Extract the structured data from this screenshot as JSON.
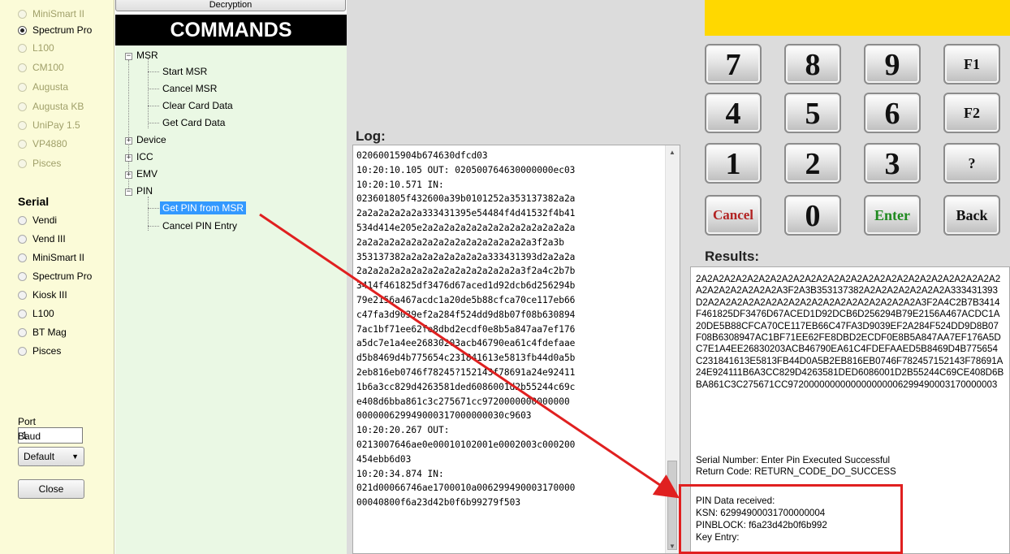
{
  "devices_usb": [
    {
      "label": "MiniSmart II",
      "selected": false,
      "enabled": false
    },
    {
      "label": "Spectrum Pro",
      "selected": true,
      "enabled": true
    },
    {
      "label": "L100",
      "selected": false,
      "enabled": false
    },
    {
      "label": "CM100",
      "selected": false,
      "enabled": false
    },
    {
      "label": "Augusta",
      "selected": false,
      "enabled": false
    },
    {
      "label": "Augusta KB",
      "selected": false,
      "enabled": false
    },
    {
      "label": "UniPay 1.5",
      "selected": false,
      "enabled": false
    },
    {
      "label": "VP4880",
      "selected": false,
      "enabled": false
    },
    {
      "label": "Pisces",
      "selected": false,
      "enabled": false
    }
  ],
  "serial": {
    "title": "Serial",
    "devices": [
      {
        "label": "Vendi"
      },
      {
        "label": "Vend III"
      },
      {
        "label": "MiniSmart II"
      },
      {
        "label": "Spectrum Pro"
      },
      {
        "label": "Kiosk III"
      },
      {
        "label": "L100"
      },
      {
        "label": "BT Mag"
      },
      {
        "label": "Pisces"
      }
    ]
  },
  "port": {
    "label": "Port",
    "value": "1"
  },
  "baud": {
    "label": "Baud",
    "value": "Default",
    "arrow": "▼"
  },
  "close_label": "Close",
  "commands": {
    "top_button": "Decryption",
    "header": "COMMANDS",
    "msr": {
      "label": "MSR",
      "children": [
        "Start MSR",
        "Cancel MSR",
        "Clear Card Data",
        "Get Card Data"
      ]
    },
    "device": "Device",
    "icc": "ICC",
    "emv": "EMV",
    "pin": {
      "label": "PIN",
      "children": [
        "Get PIN from MSR",
        "Cancel PIN Entry"
      ]
    }
  },
  "log": {
    "label": "Log:",
    "text": "02060015904b674630dfcd03\n10:20:10.105 OUT: 020500764630000000ec03\n10:20:10.571 IN:\n023601805f432600a39b0101252a353137382a2a\n2a2a2a2a2a2a333431395e54484f4d41532f4b41\n534d414e205e2a2a2a2a2a2a2a2a2a2a2a2a2a2a\n2a2a2a2a2a2a2a2a2a2a2a2a2a2a2a2a3f2a3b\n353137382a2a2a2a2a2a2a2a333431393d2a2a2a\n2a2a2a2a2a2a2a2a2a2a2a2a2a2a2a3f2a4c2b7b\n3414f461825df3476d67aced1d92dcb6d256294b\n79e2156a467acdc1a20de5b88cfca70ce117eb66\nc47fa3d9039ef2a284f524dd9d8b07f08b630894\n7ac1bf71ee62fe8dbd2ecdf0e8b5a847aa7ef176\na5dc7e1a4ee26830203acb46790ea61c4fdefaae\nd5b8469d4b775654c231841613e5813fb44d0a5b\n2eb816eb0746f78245?152143f78691a24e92411\n1b6a3cc829d4263581ded6086001d2b55244c69c\ne408d6bba861c3c275671cc9720000000000000\n000000629949000317000000030c9603\n10:20:20.267 OUT:\n0213007646ae0e00010102001e0002003c000200\n454ebb6d03\n10:20:34.874 IN:\n021d00066746ae1700010a006299490003170000\n00040800f6a23d42b0f6b99279f503"
  },
  "keypad": {
    "row1": [
      "7",
      "8",
      "9",
      "F1"
    ],
    "row2": [
      "4",
      "5",
      "6",
      "F2"
    ],
    "row3": [
      "1",
      "2",
      "3",
      "?"
    ],
    "row4": [
      "Cancel",
      "0",
      "Enter",
      "Back"
    ]
  },
  "results": {
    "label": "Results:",
    "hex": "2A2A2A2A2A2A2A2A2A2A2A2A2A2A2A2A2A2A2A2A2A2A2A2A2A2A2A2A2A2A2A2A2A2A3F2A3B353137382A2A2A2A2A2A2A2A333431393D2A2A2A2A2A2A2A2A2A2A2A2A2A2A2A2A2A2A2A3F2A4C2B7B3414F461825DF3476D67ACED1D92DCB6D256294B79E2156A467ACDC1A20DE5B88CFCA70CE117EB66C47FA3D9039EF2A284F524DD9D8B07F08B6308947AC1BF71EE62FE8DBD2ECDF0E8B5A847AA7EF176A5DC7E1A4EE26830203ACB46790EA61C4FDEFAAED5B8469D4B775654C231841613E5813FB44D0A5B2EB816EB0746F782457152143F78691A24E924111B6A3CC829D4263581DED6086001D2B55244C69CE408D6BBA861C3C275671CC9720000000000000000006299490003170000003",
    "serial_number": "Serial Number: Enter Pin Executed Successful",
    "return_code": "Return Code: RETURN_CODE_DO_SUCCESS",
    "pin_received": "PIN Data received:",
    "ksn": "KSN: 62994900031700000004",
    "pinblock": "PINBLOCK: f6a23d42b0f6b992",
    "key_entry": "Key Entry:"
  },
  "colors": {
    "display_yellow": "#ffd800",
    "annotation_red": "#e02020",
    "selection_blue": "#3399ff",
    "cancel_red": "#b22222",
    "enter_green": "#1f8a1f"
  }
}
